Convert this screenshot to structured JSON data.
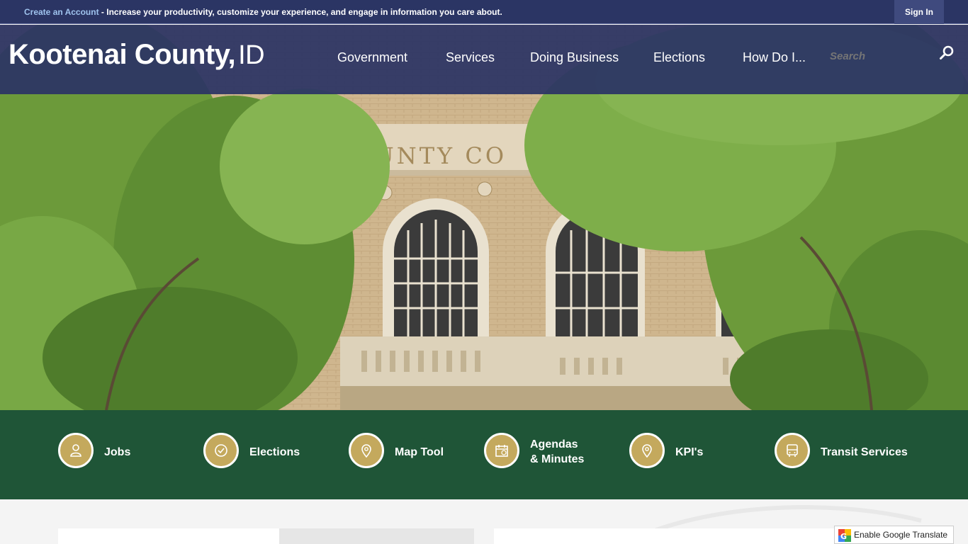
{
  "topbar": {
    "create_account_link": "Create an Account",
    "message": " - Increase your productivity, customize your experience, and engage in information you care about.",
    "sign_in": "Sign In"
  },
  "header": {
    "site_name": "Kootenai County,",
    "state": "ID",
    "nav": [
      "Government",
      "Services",
      "Doing Business",
      "Elections",
      "How Do I..."
    ],
    "search_placeholder": "Search"
  },
  "hero": {
    "building_inscription": "COUNTY CO"
  },
  "quick_links": [
    {
      "label": "Jobs",
      "icon": "person-icon"
    },
    {
      "label": "Elections",
      "icon": "checkmark-icon"
    },
    {
      "label": "Map Tool",
      "icon": "map-pin-icon"
    },
    {
      "label": "Agendas",
      "label2": "& Minutes",
      "icon": "calendar-icon"
    },
    {
      "label": "KPI's",
      "icon": "map-pin-icon"
    },
    {
      "label": "Transit Services",
      "icon": "bus-icon"
    }
  ],
  "translate": {
    "label": "Enable Google Translate"
  },
  "colors": {
    "header_bg": "#2b3564",
    "quick_links_bg": "#1f5537",
    "quick_icon_gold": "#c4a95d",
    "account_link": "#9fc3ee"
  }
}
